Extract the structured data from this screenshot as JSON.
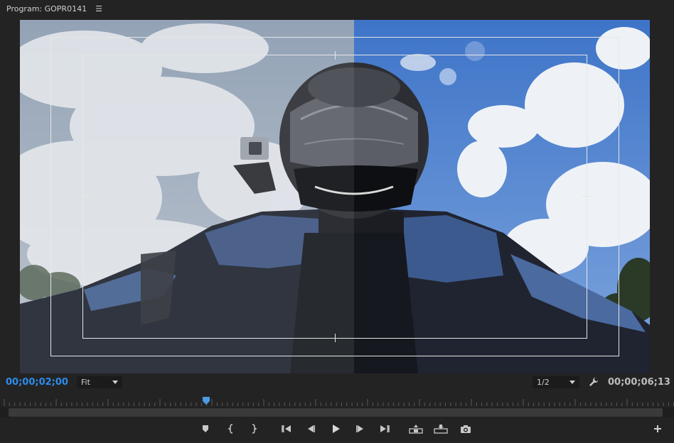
{
  "header": {
    "title": "Program: GOPR0141",
    "menu_icon": "hamburger-icon"
  },
  "viewer": {
    "scene": "motorcyclist in helmet and blue jacket with action camera, sky with clouds",
    "safe_margins_visible": true
  },
  "timecode": {
    "current": "00;00;02;00",
    "duration": "00;00;06;13"
  },
  "zoom": {
    "selected": "Fit"
  },
  "resolution": {
    "selected": "1/2"
  },
  "settings_icon": "wrench-icon",
  "playhead_position": 0.31,
  "transport": {
    "buttons": [
      {
        "name": "add-marker-button",
        "icon": "marker-icon"
      },
      {
        "name": "mark-in-button",
        "icon": "mark-in-icon"
      },
      {
        "name": "mark-out-button",
        "icon": "mark-out-icon"
      },
      {
        "name": "go-to-in-button",
        "icon": "go-to-in-icon"
      },
      {
        "name": "step-back-button",
        "icon": "step-back-icon"
      },
      {
        "name": "play-button",
        "icon": "play-icon"
      },
      {
        "name": "step-forward-button",
        "icon": "step-forward-icon"
      },
      {
        "name": "go-to-out-button",
        "icon": "go-to-out-icon"
      },
      {
        "name": "lift-button",
        "icon": "lift-icon"
      },
      {
        "name": "extract-button",
        "icon": "extract-icon"
      },
      {
        "name": "export-frame-button",
        "icon": "camera-icon"
      }
    ],
    "add_button_icon": "plus-icon"
  },
  "colors": {
    "accent": "#2d8ceb",
    "panel": "#232323",
    "playhead": "#4a9be0"
  }
}
